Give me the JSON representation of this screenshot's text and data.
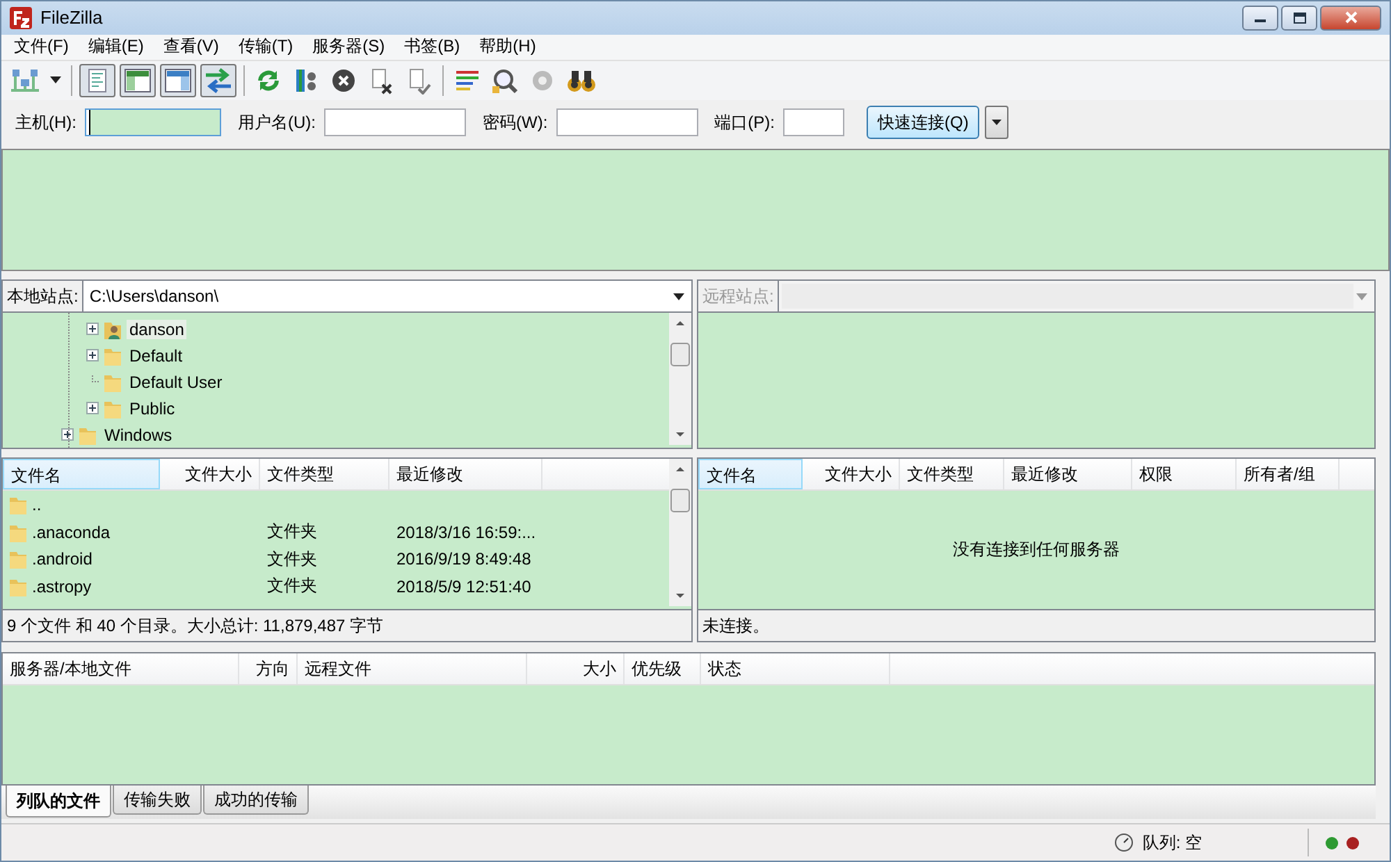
{
  "window": {
    "title": "FileZilla"
  },
  "menu": [
    "文件(F)",
    "编辑(E)",
    "查看(V)",
    "传输(T)",
    "服务器(S)",
    "书签(B)",
    "帮助(H)"
  ],
  "toolbar": {
    "view_toggles": [
      {
        "pressed": true
      },
      {
        "pressed": true
      },
      {
        "pressed": true
      },
      {
        "pressed": true
      }
    ]
  },
  "quickconnect": {
    "fields": [
      {
        "label": "主机(H):",
        "focused": true
      },
      {
        "label": "用户名(U):",
        "focused": false
      },
      {
        "label": "密码(W):",
        "focused": false
      },
      {
        "label": "端口(P):",
        "focused": false
      }
    ],
    "button": "快速连接(Q)"
  },
  "local": {
    "label": "本地站点:",
    "path": "C:\\Users\\danson\\",
    "tree": [
      {
        "children": [
          {
            "label": "danson",
            "kind": "user-folder",
            "expandable": true,
            "selected": true
          },
          {
            "label": "Default",
            "kind": "folder",
            "expandable": true,
            "selected": false
          },
          {
            "label": "Default User",
            "kind": "folder",
            "expandable": false,
            "selected": false
          },
          {
            "label": "Public",
            "kind": "folder",
            "expandable": true,
            "selected": false
          }
        ]
      },
      {
        "label": "Windows",
        "kind": "folder",
        "expandable": true,
        "selected": false
      }
    ],
    "columns": [
      "文件名",
      "文件大小",
      "文件类型",
      "最近修改"
    ],
    "rows": [
      {
        "name": ".."
      },
      {
        "name": ".anaconda",
        "type": "文件夹",
        "modified": "2018/3/16 16:59:..."
      },
      {
        "name": ".android",
        "type": "文件夹",
        "modified": "2016/9/19 8:49:48"
      },
      {
        "name": ".astropy",
        "type": "文件夹",
        "modified": "2018/5/9 12:51:40"
      }
    ],
    "summary": "9 个文件 和 40 个目录。大小总计: 11,879,487 字节"
  },
  "remote": {
    "label": "远程站点:",
    "disabled": true,
    "columns": [
      "文件名",
      "文件大小",
      "文件类型",
      "最近修改",
      "权限",
      "所有者/组"
    ],
    "message": "没有连接到任何服务器",
    "summary": "未连接。"
  },
  "queue": {
    "columns": [
      "服务器/本地文件",
      "方向",
      "远程文件",
      "大小",
      "优先级",
      "状态"
    ],
    "tabs": [
      {
        "label": "列队的文件",
        "selected": true
      },
      {
        "label": "传输失败",
        "selected": false
      },
      {
        "label": "成功的传输",
        "selected": false
      }
    ]
  },
  "status": {
    "queue": "队列: 空",
    "lights": [
      {
        "color": "#2e9a32"
      },
      {
        "color": "#a82020"
      }
    ]
  }
}
